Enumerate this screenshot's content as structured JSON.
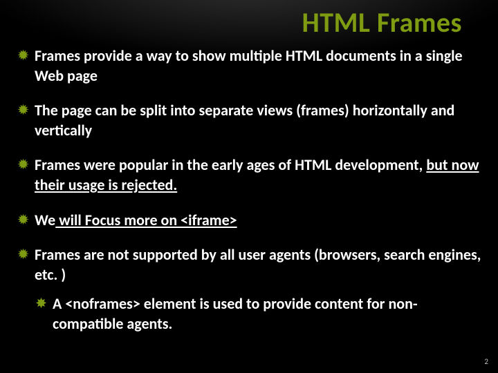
{
  "title": "HTML Frames",
  "bullets": [
    {
      "lead": "Frames",
      "rest": " provide a way to show multiple HTML documents in a single Web page"
    },
    {
      "lead": "The",
      "rest": " page can be split into separate views (frames) horizontally and vertically"
    },
    {
      "lead": "Frames",
      "rest_a": " were popular in the early ages of HTML development, ",
      "u": "but now their usage is rejected."
    },
    {
      "lead": "We",
      "u": " will Focus more on <iframe>"
    },
    {
      "lead": "Frames",
      "rest": " are not supported by all user agents (browsers, search engines, etc. )",
      "sub": [
        {
          "lead": "A",
          "rest": " <noframes> element is used to provide content for non-compatible agents."
        }
      ]
    }
  ],
  "page_number": "2"
}
